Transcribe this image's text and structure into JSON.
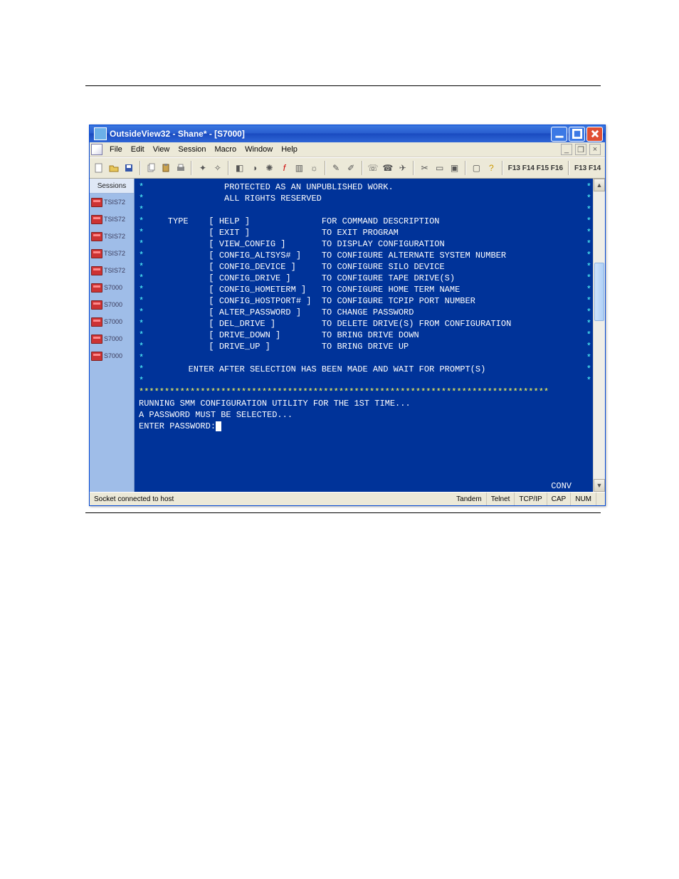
{
  "window": {
    "title": "OutsideView32 - Shane* - [S7000]"
  },
  "menu": {
    "items": [
      "File",
      "Edit",
      "View",
      "Session",
      "Macro",
      "Window",
      "Help"
    ]
  },
  "toolbar": {
    "fkeys_left": "F13 F14 F15 F16",
    "fkeys_right": "F13 F14"
  },
  "sessions": {
    "header": "Sessions",
    "items": [
      "TSIS72",
      "TSIS72",
      "TSIS72",
      "TSIS72",
      "TSIS72",
      "S7000",
      "S7000",
      "S7000",
      "S7000",
      "S7000"
    ]
  },
  "terminal": {
    "header_lines": [
      "               PROTECTED AS AN UNPUBLISHED WORK.",
      "               ALL RIGHTS RESERVED",
      ""
    ],
    "type_label": "    TYPE",
    "commands": [
      {
        "cmd": "[ HELP ]",
        "desc": "FOR COMMAND DESCRIPTION"
      },
      {
        "cmd": "[ EXIT ]",
        "desc": "TO EXIT PROGRAM"
      },
      {
        "cmd": "[ VIEW_CONFIG ]",
        "desc": "TO DISPLAY CONFIGURATION"
      },
      {
        "cmd": "[ CONFIG_ALTSYS# ]",
        "desc": "TO CONFIGURE ALTERNATE SYSTEM NUMBER"
      },
      {
        "cmd": "[ CONFIG_DEVICE ]",
        "desc": "TO CONFIGURE SILO DEVICE"
      },
      {
        "cmd": "[ CONFIG_DRIVE ]",
        "desc": "TO CONFIGURE TAPE DRIVE(S)"
      },
      {
        "cmd": "[ CONFIG_HOMETERM ]",
        "desc": "TO CONFIGURE HOME TERM NAME"
      },
      {
        "cmd": "[ CONFIG_HOSTPORT# ]",
        "desc": "TO CONFIGURE TCPIP PORT NUMBER"
      },
      {
        "cmd": "[ ALTER_PASSWORD ]",
        "desc": "TO CHANGE PASSWORD"
      },
      {
        "cmd": "[ DEL_DRIVE ]",
        "desc": "TO DELETE DRIVE(S) FROM CONFIGURATION"
      },
      {
        "cmd": "[ DRIVE_DOWN ]",
        "desc": "TO BRING DRIVE DOWN"
      },
      {
        "cmd": "[ DRIVE_UP ]",
        "desc": "TO BRING DRIVE UP"
      }
    ],
    "prompt_hint": "        ENTER AFTER SELECTION HAS BEEN MADE AND WAIT FOR PROMPT(S)",
    "star_row": "********************************************************************************",
    "body_lines": [
      "RUNNING SMM CONFIGURATION UTILITY FOR THE 1ST TIME...",
      "A PASSWORD MUST BE SELECTED...",
      ""
    ],
    "input_prompt": "ENTER PASSWORD:",
    "mode": "CONV"
  },
  "statusbar": {
    "left": "Socket connected to host",
    "panes": [
      "Tandem",
      "Telnet",
      "TCP/IP",
      "CAP",
      "NUM",
      ""
    ]
  }
}
